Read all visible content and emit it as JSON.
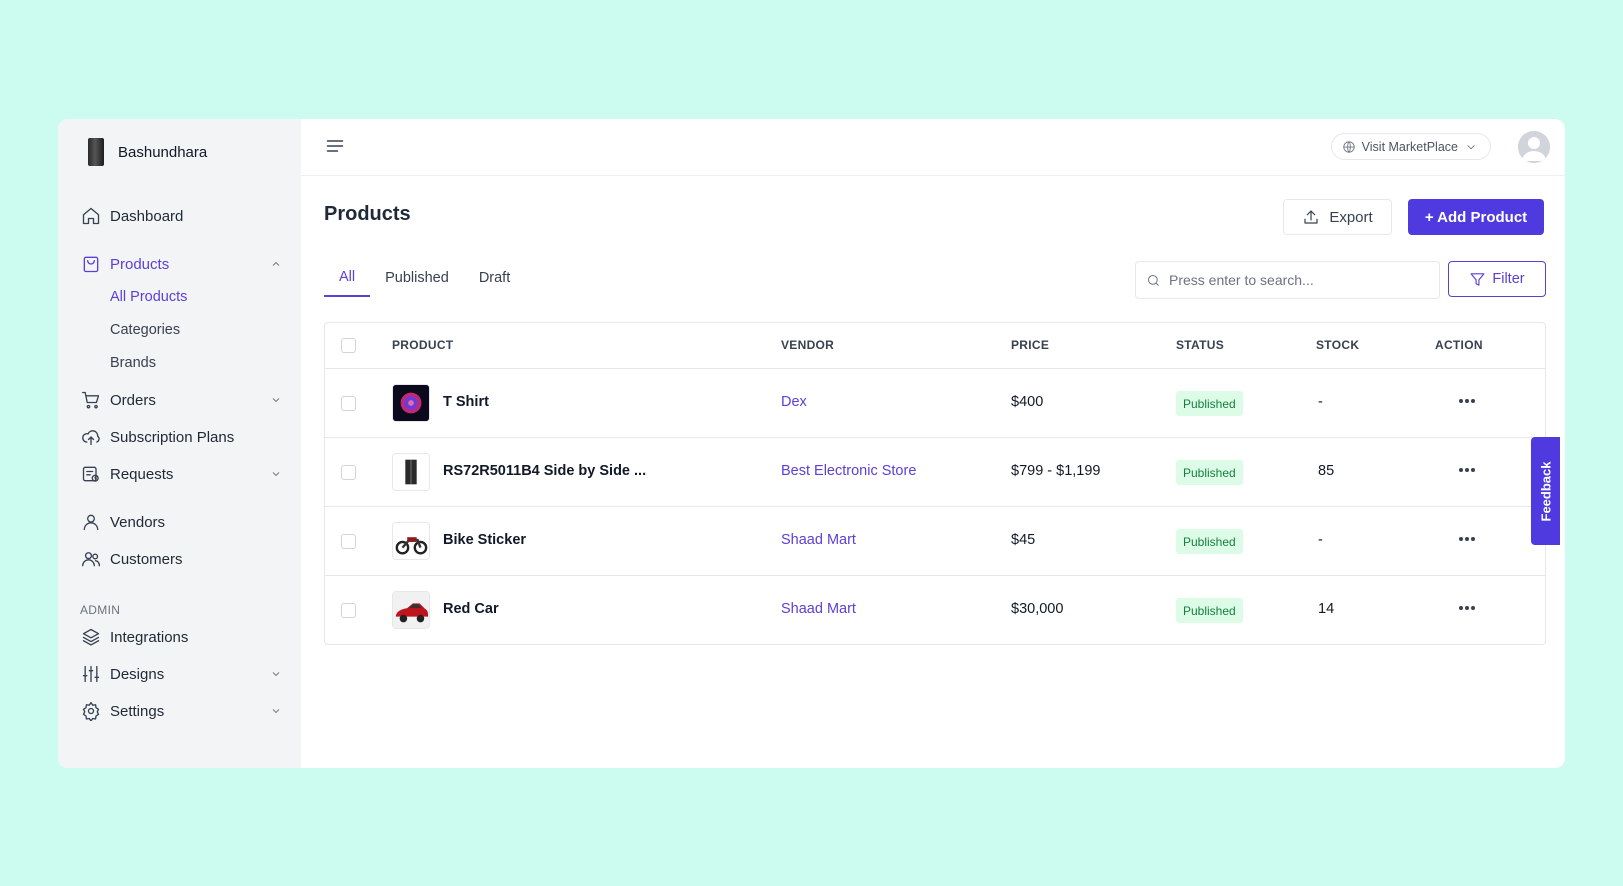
{
  "brand": {
    "name": "Bashundhara"
  },
  "sidebar": {
    "items": [
      {
        "label": "Dashboard",
        "icon": "home-icon"
      },
      {
        "label": "Products",
        "icon": "shopping-bag-icon",
        "sub": [
          "All Products",
          "Categories",
          "Brands"
        ]
      },
      {
        "label": "Orders",
        "icon": "cart-icon"
      },
      {
        "label": "Subscription Plans",
        "icon": "cloud-upload-icon"
      },
      {
        "label": "Requests",
        "icon": "request-icon"
      },
      {
        "label": "Vendors",
        "icon": "user-icon"
      },
      {
        "label": "Customers",
        "icon": "users-icon"
      }
    ],
    "section_label": "ADMIN",
    "admin_items": [
      {
        "label": "Integrations",
        "icon": "layers-icon"
      },
      {
        "label": "Designs",
        "icon": "sliders-icon"
      },
      {
        "label": "Settings",
        "icon": "gear-icon"
      }
    ]
  },
  "topbar": {
    "visit_label": "Visit MarketPlace"
  },
  "page": {
    "title": "Products",
    "export_label": "Export",
    "add_label": "+ Add Product",
    "tabs": [
      "All",
      "Published",
      "Draft"
    ],
    "search_placeholder": "Press enter to search...",
    "filter_label": "Filter"
  },
  "table": {
    "headers": [
      "PRODUCT",
      "VENDOR",
      "PRICE",
      "STATUS",
      "STOCK",
      "ACTION"
    ],
    "rows": [
      {
        "name": "T Shirt",
        "vendor": "Dex",
        "price": "$400",
        "status": "Published",
        "stock": "-"
      },
      {
        "name": "RS72R5011B4 Side by Side ...",
        "vendor": "Best Electronic Store",
        "price": "$799 - $1,199",
        "status": "Published",
        "stock": "85"
      },
      {
        "name": "Bike Sticker",
        "vendor": "Shaad Mart",
        "price": "$45",
        "status": "Published",
        "stock": "-"
      },
      {
        "name": "Red Car",
        "vendor": "Shaad Mart",
        "price": "$30,000",
        "status": "Published",
        "stock": "14"
      }
    ]
  },
  "feedback_label": "Feedback",
  "colors": {
    "accent": "#4f3ae0",
    "background": "#ccfcf0",
    "status_bg": "#dcfce7",
    "status_text": "#15803d"
  }
}
